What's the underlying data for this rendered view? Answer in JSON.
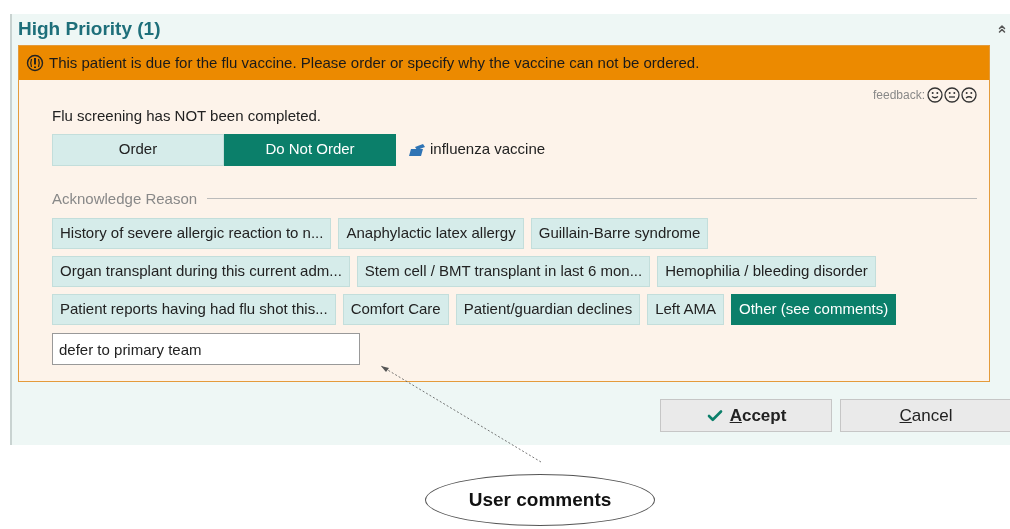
{
  "section": {
    "title": "High Priority (1)"
  },
  "alert": {
    "message": "This patient is due for the flu vaccine. Please order or specify why the vaccine can not be ordered.",
    "feedback_label": "feedback:"
  },
  "screening_status": "Flu screening has NOT been completed.",
  "order_options": [
    {
      "label": "Order",
      "selected": false
    },
    {
      "label": "Do Not Order",
      "selected": true
    }
  ],
  "order_item": "influenza vaccine",
  "acknowledge_heading": "Acknowledge Reason",
  "reason_rows": [
    [
      {
        "label": "History of severe allergic reaction to n...",
        "selected": false
      },
      {
        "label": "Anaphylactic latex allergy",
        "selected": false
      },
      {
        "label": "Guillain-Barre syndrome",
        "selected": false
      }
    ],
    [
      {
        "label": "Organ transplant during this current adm...",
        "selected": false
      },
      {
        "label": "Stem cell / BMT transplant in last 6 mon...",
        "selected": false
      },
      {
        "label": "Hemophilia / bleeding disorder",
        "selected": false
      }
    ],
    [
      {
        "label": "Patient reports having had flu shot this...",
        "selected": false
      },
      {
        "label": "Comfort Care",
        "selected": false
      },
      {
        "label": "Patient/guardian declines",
        "selected": false
      },
      {
        "label": "Left AMA",
        "selected": false
      },
      {
        "label": "Other (see comments)",
        "selected": true
      }
    ]
  ],
  "comment_field": {
    "value": "defer to primary team"
  },
  "buttons": [
    {
      "kind": "accept",
      "label": "Accept"
    },
    {
      "kind": "cancel",
      "label": "Cancel"
    }
  ],
  "annotation": {
    "label": "User comments"
  }
}
